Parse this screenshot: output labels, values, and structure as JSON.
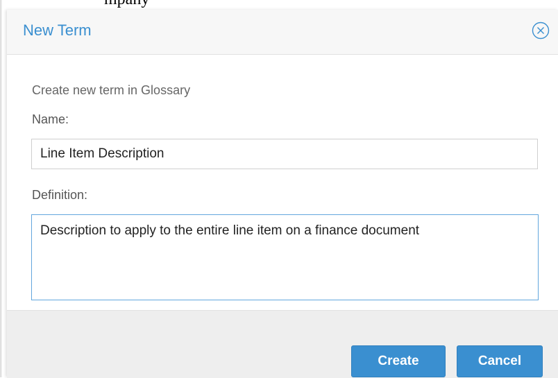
{
  "background": {
    "partial_text": "mpany"
  },
  "dialog": {
    "title": "New Term",
    "close_icon": "circle-x-icon",
    "subtitle": "Create new term in Glossary",
    "name_label": "Name:",
    "name_value": "Line Item Description",
    "definition_label": "Definition:",
    "definition_value": "Description to apply to the entire line item on a finance document",
    "create_label": "Create",
    "cancel_label": "Cancel"
  },
  "colors": {
    "accent": "#3a8fd0",
    "header_bg": "#f7f7f7",
    "footer_bg": "#eeeeee",
    "focus_border": "#62a6dd"
  }
}
